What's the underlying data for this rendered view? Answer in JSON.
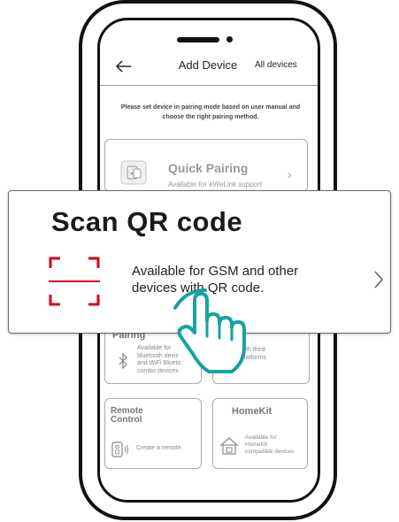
{
  "header": {
    "title": "Add Device",
    "right_link": "All devices"
  },
  "instructions": "Please set device in pairing mode based on user manual and choose the right pairing method.",
  "quick_pairing": {
    "title": "Quick Pairing",
    "subtitle": "Available for eWeLink support"
  },
  "pairing_card": {
    "title": "Pairing",
    "subtitle_lines": [
      "Available for",
      "bluetooth devic",
      "and WiFi Blueto",
      "combo devices"
    ]
  },
  "link_card": {
    "subtitle_lines": [
      "nk with third-",
      "art platforms"
    ]
  },
  "remote_card": {
    "title_lines": [
      "Remote",
      "Control"
    ],
    "subtitle": "Create a remote."
  },
  "homekit_card": {
    "title": "HomeKit",
    "subtitle_lines": [
      "Available for",
      "HomeKit",
      "compatible devices"
    ]
  },
  "scan_popup": {
    "title": "Scan QR code",
    "desc_lines": [
      "Available for GSM and other",
      "devices with QR code."
    ],
    "accent_color": "#d7001a"
  },
  "hand_color": "#17a2a2",
  "icons": [
    "back-arrow-icon",
    "quick-pairing-icon",
    "bluetooth-icon",
    "remote-icon",
    "house-icon",
    "qr-scan-icon",
    "chevron-right-icon",
    "hand-pointer-icon"
  ]
}
